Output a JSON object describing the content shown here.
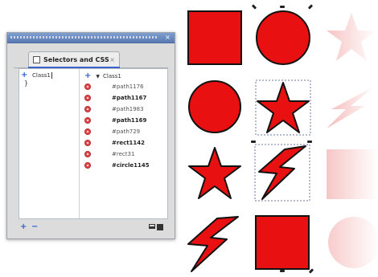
{
  "dialog": {
    "tab_label": "Selectors and CSS",
    "tab_close": "×",
    "left_selector_text": "Class1",
    "left_brace": "}",
    "right_header": "Class1",
    "items": [
      {
        "label": "#path1176",
        "bold": false
      },
      {
        "label": "#path1167",
        "bold": true
      },
      {
        "label": "#path1983",
        "bold": false
      },
      {
        "label": "#path1169",
        "bold": true
      },
      {
        "label": "#path729",
        "bold": false
      },
      {
        "label": "#rect1142",
        "bold": true
      },
      {
        "label": "#rect31",
        "bold": false
      },
      {
        "label": "#circle1145",
        "bold": true
      }
    ],
    "plus_symbol": "+",
    "minus_symbol": "−",
    "titlebar_close": "×"
  },
  "canvas": {
    "fill_color": "#e81010",
    "stroke_color": "#111111",
    "shapes": [
      {
        "kind": "square"
      },
      {
        "kind": "circle"
      },
      {
        "kind": "star-faded"
      },
      {
        "kind": "circle"
      },
      {
        "kind": "star"
      },
      {
        "kind": "arrow-faded"
      },
      {
        "kind": "star"
      },
      {
        "kind": "lightning"
      },
      {
        "kind": "square-faded"
      },
      {
        "kind": "lightning"
      },
      {
        "kind": "square"
      },
      {
        "kind": "circle-faded"
      }
    ]
  }
}
